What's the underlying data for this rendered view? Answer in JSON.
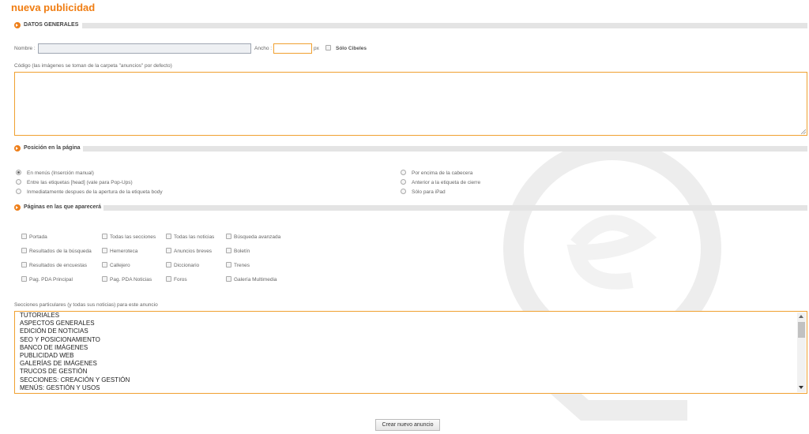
{
  "page": {
    "title": "nueva publicidad"
  },
  "general": {
    "section_label": "DATOS GENERALES",
    "name_label": "Nombre :",
    "name_value": "",
    "width_label": "Ancho :",
    "width_value": "",
    "width_unit": "px",
    "solo_cibeles_label": "Sólo Cibeles",
    "code_label": "Código (las imágenes se toman de la carpeta \"anuncios\" por defecto)",
    "code_value": ""
  },
  "position": {
    "section_label": "Posición en la página",
    "options": [
      {
        "label": "En menús (Inserción manual)",
        "selected": true
      },
      {
        "label": "Entre las etiquetas [head] (vale para Pop-Ups)",
        "selected": false
      },
      {
        "label": "Inmediatamente despues de la apertura de la etiqueta body",
        "selected": false
      },
      {
        "label": "Por encima de la cabecera",
        "selected": false
      },
      {
        "label": "Anterior a la etiqueta de cierre",
        "selected": false
      },
      {
        "label": "Sólo para iPad",
        "selected": false
      }
    ]
  },
  "pages": {
    "section_label": "Páginas en las que aparecerá",
    "items": [
      "Portada",
      "Todas las secciones",
      "Todas las noticias",
      "Búsqueda avanzada",
      "Resultados de la búsqueda",
      "Hemeroteca",
      "Anuncios breves",
      "Boletín",
      "Resultados de encuestas",
      "Callejero",
      "Diccionario",
      "Trenes",
      "Pag. PDA Principal",
      "Pag. PDA Noticias",
      "Foros",
      "Galería Multimedia"
    ]
  },
  "sections": {
    "label": "Secciones particulares (y todas sus noticias) para este anuncio",
    "items": [
      "TUTORIALES",
      "ASPECTOS GENERALES",
      "EDICIÓN DE NOTICIAS",
      "SEO Y POSICIONAMIENTO",
      "BANCO DE IMÁGENES",
      "PUBLICIDAD WEB",
      "GALERÍAS DE IMÁGENES",
      "TRUCOS DE GESTIÓN",
      "SECCIONES: CREACIÓN Y GESTIÓN",
      "MENÚS: GESTIÓN Y USOS"
    ]
  },
  "submit": {
    "label": "Crear nuevo anuncio"
  },
  "colors": {
    "accent": "#f07d12",
    "section_bar": "#e4e4e4",
    "input_focus_border": "#f0a030"
  }
}
